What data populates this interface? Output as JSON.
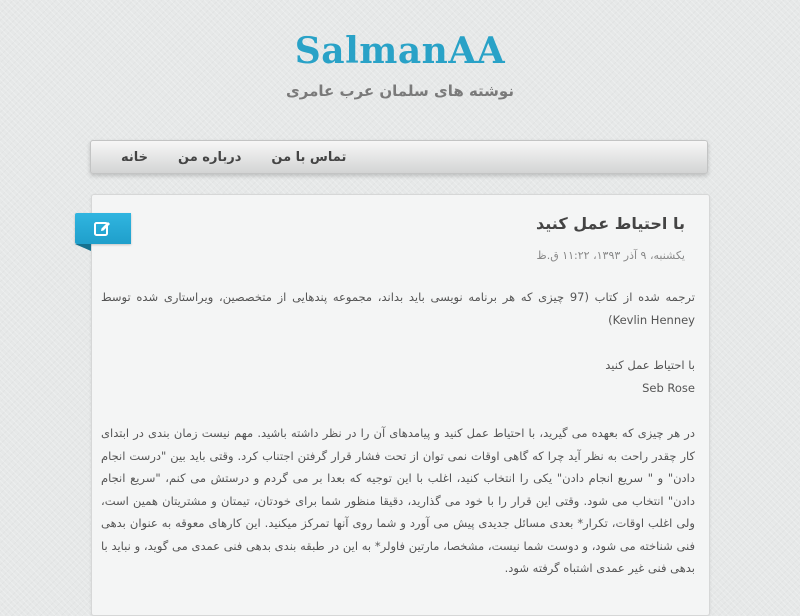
{
  "site": {
    "title": "SalmanAA",
    "subtitle": "نوشته های سلمان عرب عامری"
  },
  "nav": {
    "items": [
      "خانه",
      "درباره من",
      "تماس با من"
    ]
  },
  "post": {
    "title": "با احتیاط عمل کنید",
    "date": "یکشنبه، ۹ آذر ۱۳۹۳، ۱۱:۲۲ ق.ظ",
    "intro": "ترجمه شده از کتاب (97 چیزی که هر برنامه نویسی باید بداند، مجموعه پندهایی از متخصصین، ویراستاری شده توسط Kevlin Henney)",
    "heading_fa": "با احتیاط عمل کنید",
    "author": "Seb Rose",
    "paragraph": "در هر چیزی که بعهده می گیرید، با احتیاط عمل کنید و پیامدهای آن را در نظر داشته باشید. مهم نیست زمان بندی در ابتدای کار چقدر راحت به نظر آید چرا که گاهی اوقات نمی توان از تحت فشار قرار گرفتن اجتناب کرد. وقتی باید بین \"درست انجام دادن\" و \" سریع انجام دادن\" یکی را انتخاب کنید، اغلب با این توجیه که بعدا بر می گردم و درستش می کنم، \"سریع انجام دادن\" انتخاب می شود. وقتی این قرار را با خود می گذارید، دقیقا منظور شما برای خودتان، تیمتان و مشتریتان همین است، ولی اغلب اوقات، تکرار* بعدی مسائل جدیدی پیش می آورد و شما روی آنها تمرکز میکنید. این کارهای معوقه به عنوان بدهی فنی شناخته می شود، و دوست شما نیست، مشخصا، مارتین فاولر* به این در طبقه بندی بدهی فنی عمدی می گوید، و نباید با بدهی فنی غیر عمدی اشتباه گرفته شود."
  },
  "icons": {
    "edit": "edit-icon"
  },
  "colors": {
    "accent": "#29a2c7",
    "edit_tab": "#1f9fcb"
  }
}
